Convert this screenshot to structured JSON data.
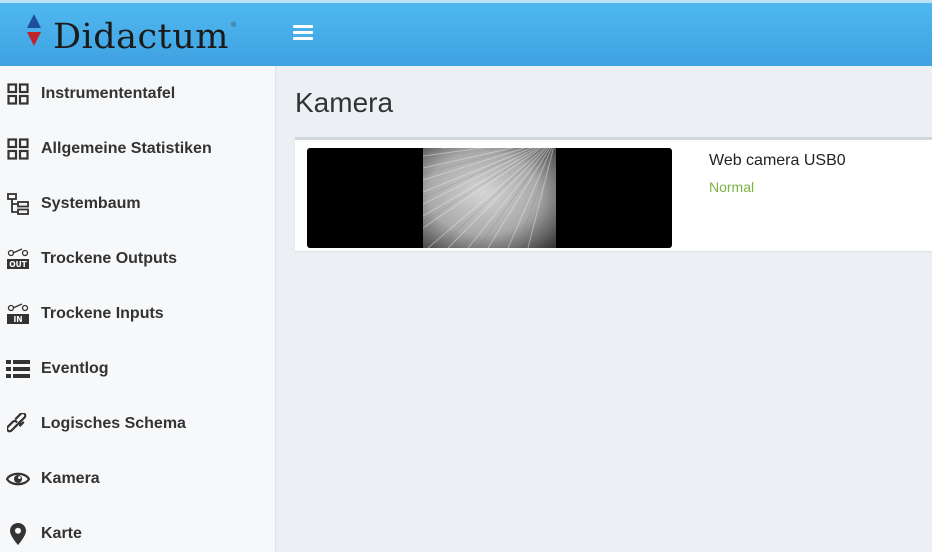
{
  "header": {
    "brand": "Didactum",
    "brand_mark": "®",
    "menu_icon": "hamburger-icon",
    "colors": {
      "bar": "#44a9e8",
      "arrow_up": "#1f4e9c",
      "arrow_down": "#c0242b"
    }
  },
  "sidebar": {
    "items": [
      {
        "label": "Instrumententafel",
        "icon": "dashboard-grid-icon"
      },
      {
        "label": "Allgemeine Statistiken",
        "icon": "statistics-grid-icon"
      },
      {
        "label": "Systembaum",
        "icon": "tree-icon"
      },
      {
        "label": "Trockene Outputs",
        "icon": "dry-output-icon",
        "icon_text": "OUT"
      },
      {
        "label": "Trockene Inputs",
        "icon": "dry-input-icon",
        "icon_text": "IN"
      },
      {
        "label": "Eventlog",
        "icon": "list-icon"
      },
      {
        "label": "Logisches Schema",
        "icon": "link-icon"
      },
      {
        "label": "Kamera",
        "icon": "eye-icon"
      },
      {
        "label": "Karte",
        "icon": "map-marker-icon"
      }
    ]
  },
  "main": {
    "title": "Kamera",
    "camera": {
      "name": "Web camera USB0",
      "status": "Normal",
      "status_color": "#7cb342"
    }
  }
}
